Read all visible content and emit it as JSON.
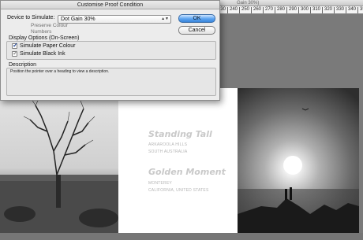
{
  "document": {
    "title_fragment": "Gain 30%)",
    "ruler_ticks": [
      "230",
      "240",
      "250",
      "260",
      "270",
      "280",
      "290",
      "300",
      "310",
      "320",
      "330",
      "340",
      "350"
    ],
    "captions": [
      {
        "title": "Standing Tall",
        "line1": "ARKAROOLA HILLS",
        "line2": "SOUTH AUSTRALIA"
      },
      {
        "title": "Golden Moment",
        "line1": "MONTEREY",
        "line2": "CALIFORNIA, UNITED STATES"
      }
    ]
  },
  "dialog": {
    "title": "Customise Proof Condition",
    "device_label": "Device to Simulate:",
    "device_value": "Dot Gain 30%",
    "preserve_label": "Preserve Colour",
    "numbers_label": "Numbers",
    "display_options_title": "Display Options (On-Screen)",
    "simulate_paper": {
      "label": "Simulate Paper Colour",
      "checked": true
    },
    "simulate_black": {
      "label": "Simulate Black Ink",
      "checked": true
    },
    "description_title": "Description",
    "description_text": "Position the pointer over a heading to view a description.",
    "ok_label": "OK",
    "cancel_label": "Cancel"
  },
  "colors": {
    "ok_button": "#3b86dc",
    "dialog_bg": "#ececec",
    "canvas_bg": "#7a7a7a"
  }
}
